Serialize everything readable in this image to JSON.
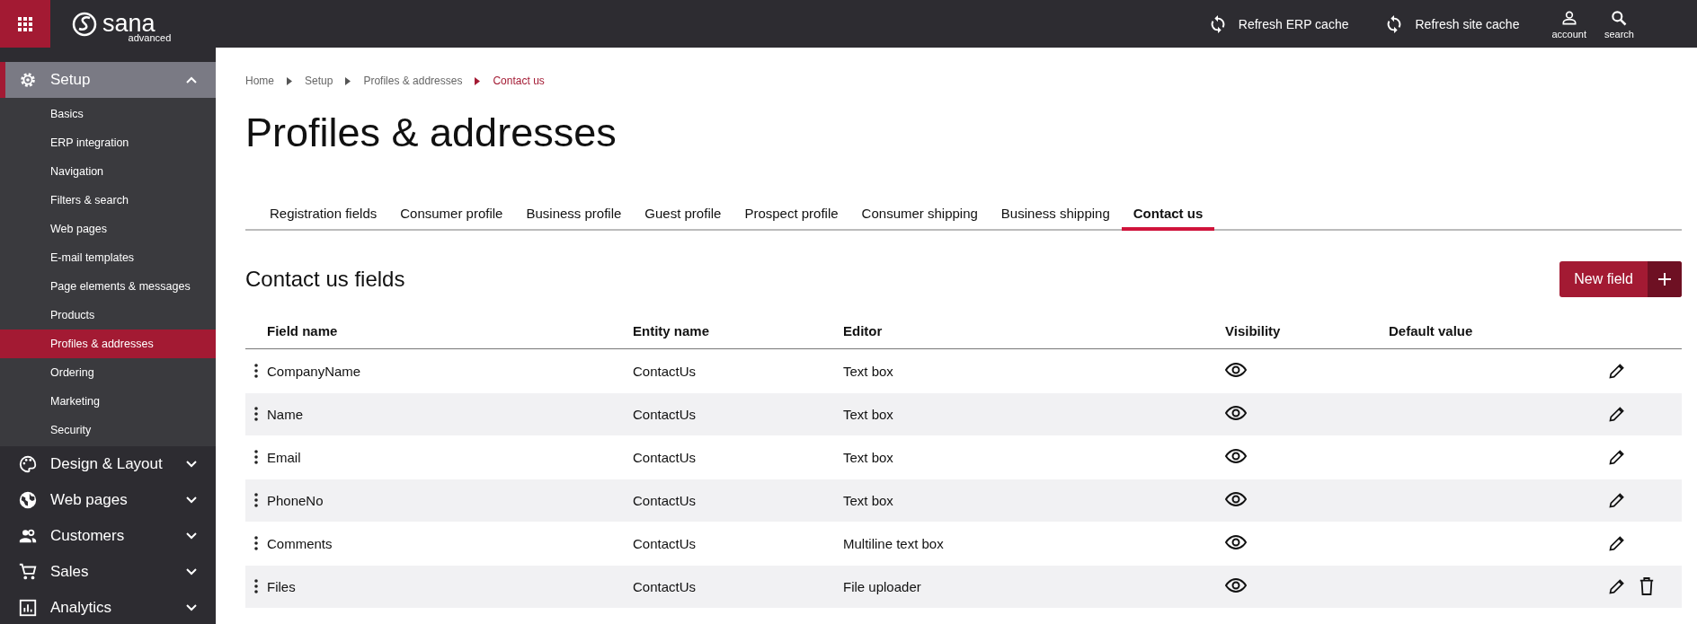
{
  "topbar": {
    "logo": {
      "name": "sana",
      "edition": "advanced"
    },
    "actions": [
      {
        "label": "Refresh ERP cache"
      },
      {
        "label": "Refresh site cache"
      }
    ],
    "icon_links": [
      {
        "kind": "account",
        "label": "account"
      },
      {
        "kind": "search",
        "label": "search"
      }
    ]
  },
  "sidebar": {
    "sections": [
      {
        "kind": "setup",
        "label": "Setup",
        "expanded": true,
        "selected": true,
        "items": [
          {
            "label": "Basics",
            "selected": false
          },
          {
            "label": "ERP integration",
            "selected": false
          },
          {
            "label": "Navigation",
            "selected": false
          },
          {
            "label": "Filters & search",
            "selected": false
          },
          {
            "label": "Web pages",
            "selected": false
          },
          {
            "label": "E-mail templates",
            "selected": false
          },
          {
            "label": "Page elements & messages",
            "selected": false
          },
          {
            "label": "Products",
            "selected": false
          },
          {
            "label": "Profiles & addresses",
            "selected": true
          },
          {
            "label": "Ordering",
            "selected": false
          },
          {
            "label": "Marketing",
            "selected": false
          },
          {
            "label": "Security",
            "selected": false
          }
        ]
      },
      {
        "kind": "design",
        "label": "Design & Layout",
        "expanded": false,
        "selected": false
      },
      {
        "kind": "globe",
        "label": "Web pages",
        "expanded": false,
        "selected": false
      },
      {
        "kind": "people",
        "label": "Customers",
        "expanded": false,
        "selected": false
      },
      {
        "kind": "cart",
        "label": "Sales",
        "expanded": false,
        "selected": false
      },
      {
        "kind": "chart",
        "label": "Analytics",
        "expanded": false,
        "selected": false
      }
    ]
  },
  "breadcrumb": [
    {
      "label": "Home",
      "current": false
    },
    {
      "label": "Setup",
      "current": false
    },
    {
      "label": "Profiles & addresses",
      "current": false
    },
    {
      "label": "Contact us",
      "current": true
    }
  ],
  "page_title": "Profiles & addresses",
  "tabs": [
    {
      "label": "Registration fields",
      "selected": false
    },
    {
      "label": "Consumer profile",
      "selected": false
    },
    {
      "label": "Business profile",
      "selected": false
    },
    {
      "label": "Guest profile",
      "selected": false
    },
    {
      "label": "Prospect profile",
      "selected": false
    },
    {
      "label": "Consumer shipping",
      "selected": false
    },
    {
      "label": "Business shipping",
      "selected": false
    },
    {
      "label": "Contact us",
      "selected": true
    }
  ],
  "section_title": "Contact us fields",
  "new_button": {
    "label": "New field"
  },
  "table": {
    "columns": [
      "Field name",
      "Entity name",
      "Editor",
      "Visibility",
      "Default value"
    ],
    "rows": [
      {
        "field_name": "CompanyName",
        "entity_name": "ContactUs",
        "editor": "Text box",
        "visible": true,
        "deletable": false
      },
      {
        "field_name": "Name",
        "entity_name": "ContactUs",
        "editor": "Text box",
        "visible": true,
        "deletable": false
      },
      {
        "field_name": "Email",
        "entity_name": "ContactUs",
        "editor": "Text box",
        "visible": true,
        "deletable": false
      },
      {
        "field_name": "PhoneNo",
        "entity_name": "ContactUs",
        "editor": "Text box",
        "visible": true,
        "deletable": false
      },
      {
        "field_name": "Comments",
        "entity_name": "ContactUs",
        "editor": "Multiline text box",
        "visible": true,
        "deletable": false
      },
      {
        "field_name": "Files",
        "entity_name": "ContactUs",
        "editor": "File uploader",
        "visible": true,
        "deletable": true
      }
    ]
  }
}
